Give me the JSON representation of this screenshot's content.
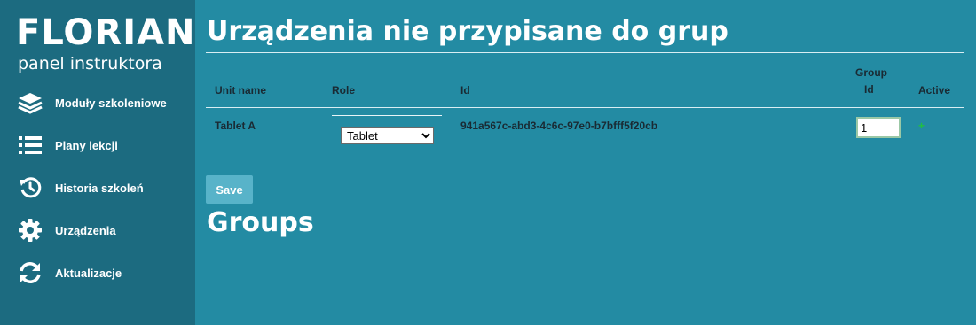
{
  "brand": {
    "title": "FLORIAN",
    "subtitle": "panel instruktora"
  },
  "sidebar": {
    "items": [
      {
        "label": "Moduły szkoleniowe",
        "icon": "layers-icon"
      },
      {
        "label": "Plany lekcji",
        "icon": "list-icon"
      },
      {
        "label": "Historia szkoleń",
        "icon": "history-icon"
      },
      {
        "label": "Urządzenia",
        "icon": "gear-icon"
      },
      {
        "label": "Aktualizacje",
        "icon": "refresh-icon"
      }
    ]
  },
  "main": {
    "title": "Urządzenia nie przypisane do grup",
    "table": {
      "headers": {
        "unit_name": "Unit name",
        "role": "Role",
        "id": "Id",
        "group_id_1": "Group",
        "group_id_2": "Id",
        "active": "Active"
      },
      "rows": [
        {
          "unit_name": "Tablet A",
          "role": "Tablet",
          "id": "941a567c-abd3-4c6c-97e0-b7bfff5f20cb",
          "group_id": "1",
          "active": "+"
        }
      ]
    },
    "save_label": "Save",
    "groups_title": "Groups"
  },
  "colors": {
    "background": "#238ba3",
    "sidebar": "#1c6b80",
    "button": "#58b3c9",
    "active_mark": "#20c040"
  }
}
